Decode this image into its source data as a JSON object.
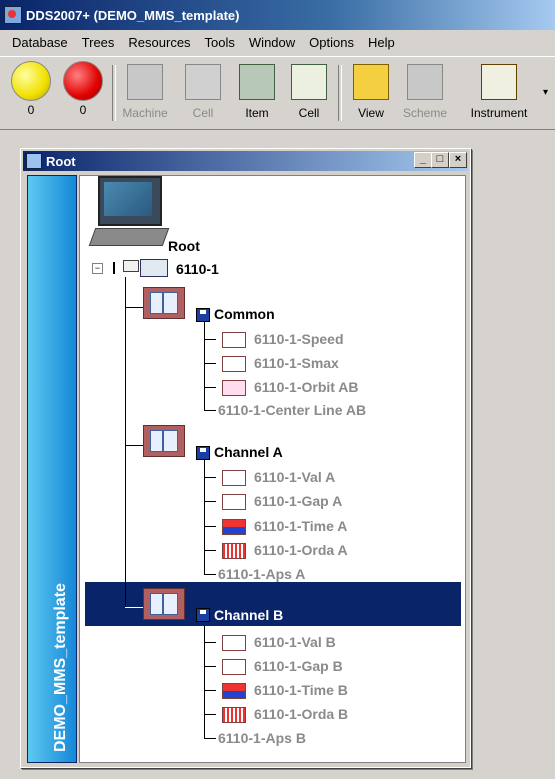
{
  "app": {
    "title": "DDS2007+ (DEMO_MMS_template)"
  },
  "menu": [
    "Database",
    "Trees",
    "Resources",
    "Tools",
    "Window",
    "Options",
    "Help"
  ],
  "toolbar": [
    {
      "label": "0",
      "icon": "yellow-ball-icon",
      "enabled": true
    },
    {
      "label": "0",
      "icon": "red-ball-icon",
      "enabled": true
    },
    {
      "label": "Machine",
      "icon": "machine-icon",
      "enabled": false
    },
    {
      "label": "Cell",
      "icon": "cell-tree-icon",
      "enabled": false
    },
    {
      "label": "Item",
      "icon": "item-icon",
      "enabled": true
    },
    {
      "label": "Cell",
      "icon": "cell-add-icon",
      "enabled": true
    },
    {
      "label": "View",
      "icon": "view-icon",
      "enabled": true
    },
    {
      "label": "Scheme",
      "icon": "scheme-icon",
      "enabled": false
    },
    {
      "label": "Instrument",
      "icon": "instrument-icon",
      "enabled": true
    }
  ],
  "window": {
    "title": "Root",
    "sidebar_label": "DEMO_MMS_template",
    "controls": {
      "minimize": "_",
      "maximize": "□",
      "close": "×"
    }
  },
  "tree": {
    "root": "Root",
    "machine": "6110-1",
    "groups": [
      {
        "name": "Common",
        "items": [
          "6110-1-Speed",
          "6110-1-Smax",
          "6110-1-Orbit AB",
          "6110-1-Center Line AB"
        ]
      },
      {
        "name": "Channel A",
        "items": [
          "6110-1-Val A",
          "6110-1-Gap A",
          "6110-1-Time A",
          "6110-1-Orda A",
          "6110-1-Aps A"
        ]
      },
      {
        "name": "Channel B",
        "selected": true,
        "items": [
          "6110-1-Val B",
          "6110-1-Gap B",
          "6110-1-Time B",
          "6110-1-Orda B",
          "6110-1-Aps B"
        ]
      }
    ]
  },
  "colors": {
    "selection": "#0a246a",
    "sidebar": "#1488d8",
    "item_text": "#8a8a8a"
  }
}
